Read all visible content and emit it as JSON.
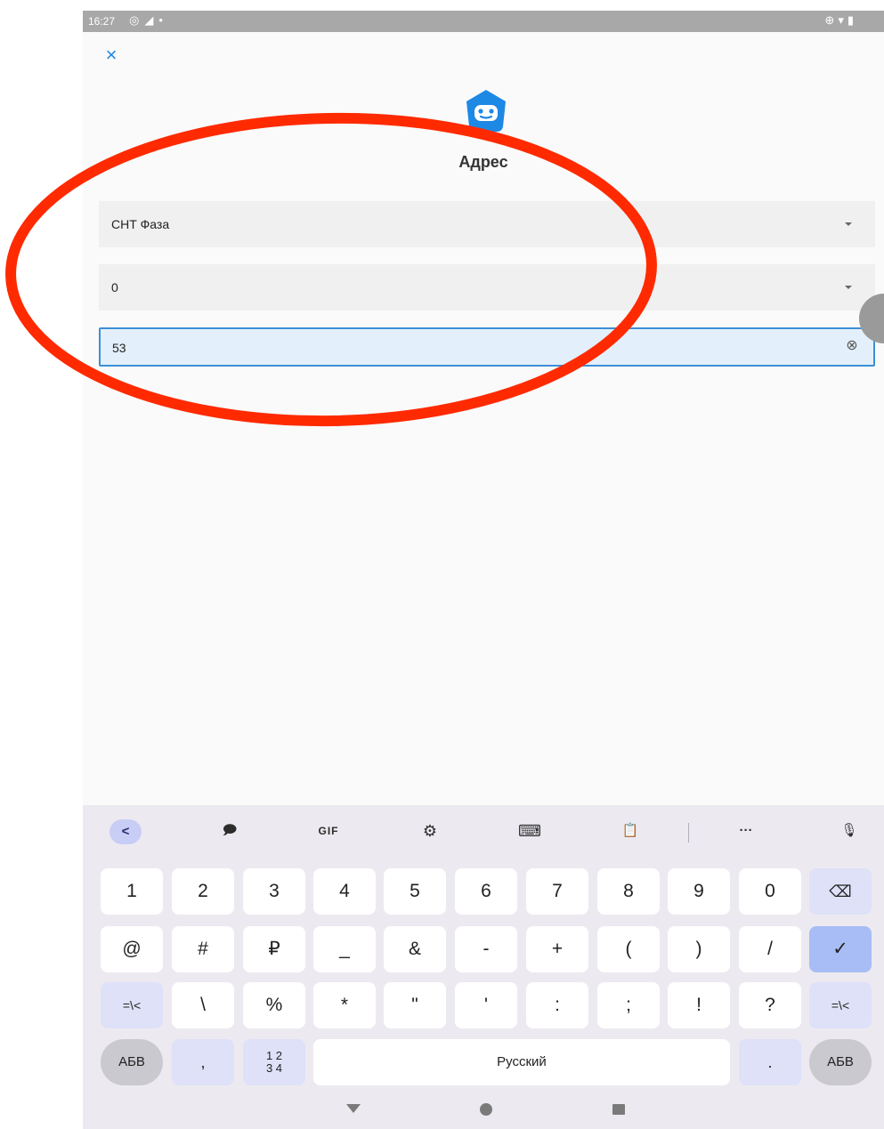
{
  "caption": "",
  "status_bar": {
    "time": "16:27",
    "left_icons": [
      "alarm-icon",
      "telegram-icon",
      "dot-icon"
    ],
    "right_icons": [
      "sync-icon",
      "wifi-icon",
      "battery-icon"
    ]
  },
  "header": {
    "close_label": "×",
    "logo": "robot-face-icon",
    "title": "Адрес"
  },
  "form": {
    "settlement": {
      "value": "СНТ Фаза"
    },
    "street": {
      "value": "0"
    },
    "house_number": {
      "value": "53"
    }
  },
  "keyboard": {
    "toolbar": {
      "back": "<",
      "sticker": "🗩",
      "gif": "GIF",
      "settings": "⚙",
      "keyboard": "⌨",
      "clipboard": "📋",
      "more": "···",
      "mic": "🎙"
    },
    "rows": [
      [
        "1",
        "2",
        "3",
        "4",
        "5",
        "6",
        "7",
        "8",
        "9",
        "0"
      ],
      [
        "@",
        "#",
        "₽",
        "_",
        "&",
        "-",
        "+",
        "(",
        ")",
        "/"
      ],
      [
        "\\",
        "%",
        "*",
        "\"",
        "'",
        ":",
        ";",
        "!",
        "?"
      ]
    ],
    "backspace": "⌫",
    "enter": "✓",
    "symbols_toggle": "=\\<",
    "abc": "АБВ",
    "comma": ",",
    "numpad": "1 2\n3 4",
    "numpad_top": "1 2",
    "numpad_bottom": "3 4",
    "space": "Русский",
    "period": "."
  },
  "colors": {
    "accent": "#1e88e5",
    "annotation": "#ff2a00"
  }
}
